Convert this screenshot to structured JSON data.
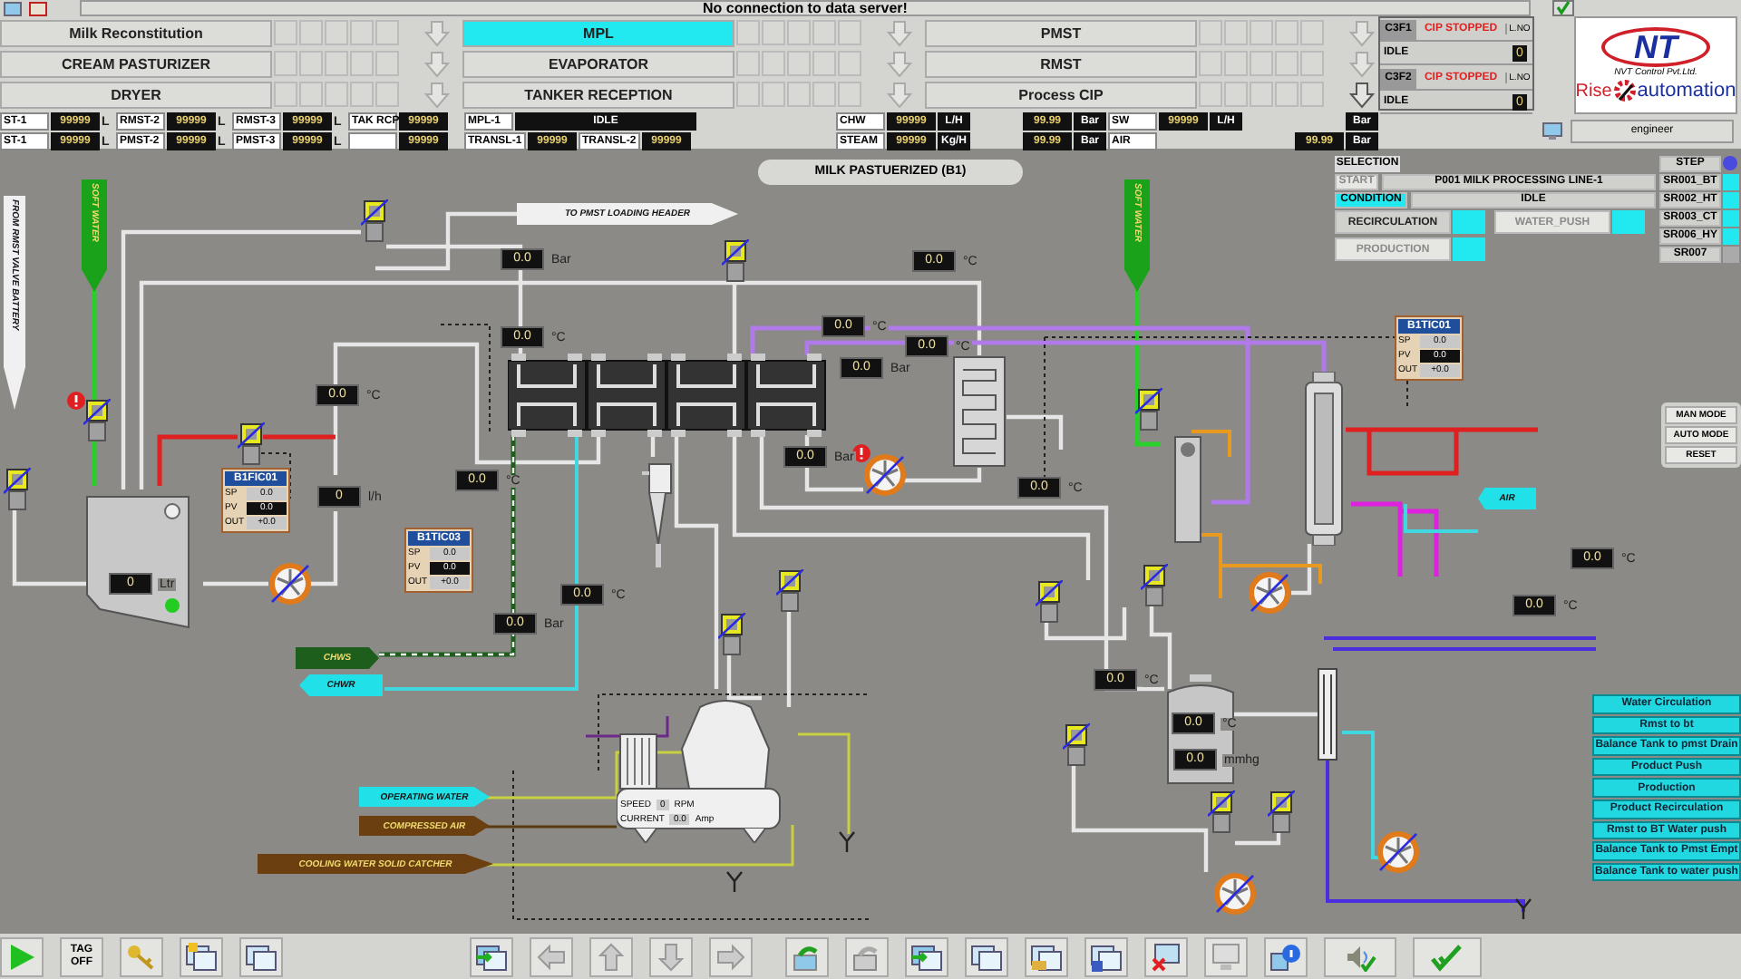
{
  "status_message": "No connection to data server!",
  "process_buttons": [
    {
      "label": "Milk Reconstitution",
      "selected": false
    },
    {
      "label": "MPL",
      "selected": true
    },
    {
      "label": "PMST",
      "selected": false
    },
    {
      "label": "CREAM PASTURIZER",
      "selected": false
    },
    {
      "label": "EVAPORATOR",
      "selected": false
    },
    {
      "label": "RMST",
      "selected": false
    },
    {
      "label": "DRYER",
      "selected": false
    },
    {
      "label": "TANKER RECEPTION",
      "selected": false
    },
    {
      "label": "Process CIP",
      "selected": false
    }
  ],
  "level_rows": [
    [
      {
        "label": "ST-1",
        "value": "99999",
        "unit": "L"
      },
      {
        "label": "RMST-2",
        "value": "99999",
        "unit": "L"
      },
      {
        "label": "RMST-3",
        "value": "99999",
        "unit": "L"
      },
      {
        "label": "TAK RCP",
        "value": "99999"
      },
      {
        "kind": "status",
        "label": "MPL-1",
        "value": "IDLE"
      }
    ],
    [
      {
        "label": "ST-1",
        "value": "99999",
        "unit": "L"
      },
      {
        "label": "PMST-2",
        "value": "99999",
        "unit": "L"
      },
      {
        "label": "PMST-3",
        "value": "99999",
        "unit": "L"
      },
      {
        "value": "99999"
      },
      {
        "kind": "pair",
        "label": "TRANSL-1",
        "value": "99999"
      },
      {
        "kind": "pair",
        "label": "TRANSL-2",
        "value": "99999"
      }
    ]
  ],
  "utility_rows": [
    [
      {
        "label": "CHW",
        "value": "99999",
        "unit": "L/H"
      },
      {
        "value": "99.99",
        "unit": "Bar"
      },
      {
        "label": "SW",
        "value": "99999",
        "unit": "L/H"
      },
      {
        "unit": "Bar"
      }
    ],
    [
      {
        "label": "STEAM",
        "value": "99999",
        "unit": "Kg/H"
      },
      {
        "value": "99.99",
        "unit": "Bar"
      },
      {
        "label": "AIR"
      },
      {
        "value": "99.99",
        "unit": "Bar"
      }
    ]
  ],
  "cip_units": [
    {
      "name": "C3F1",
      "status": "CIP STOPPED",
      "lno_label": "L.NO",
      "state": "IDLE",
      "line_no": "0"
    },
    {
      "name": "C3F2",
      "status": "CIP STOPPED",
      "lno_label": "L.NO",
      "state": "IDLE",
      "line_no": "0"
    }
  ],
  "logo": {
    "mark": "NT",
    "company": "NVT Control Pvt.Ltd.",
    "word_1": "Rise",
    "word_2": "automation"
  },
  "user": "engineer",
  "diagram": {
    "title": "MILK PASTUERIZED (B1)",
    "readings": [
      {
        "value": "0.0",
        "unit": "Bar"
      },
      {
        "value": "0.0",
        "unit": "°C"
      },
      {
        "value": "0.0",
        "unit": "°C"
      },
      {
        "value": "0",
        "unit": "l/h"
      },
      {
        "value": "0.0",
        "unit": "°C"
      },
      {
        "value": "0",
        "unit": "Ltr"
      },
      {
        "value": "0.0",
        "unit": "°C"
      },
      {
        "value": "0.0",
        "unit": "Bar"
      },
      {
        "value": "0.0",
        "unit": "°C"
      },
      {
        "value": "0.0",
        "unit": "°C"
      },
      {
        "value": "0.0",
        "unit": "°C"
      },
      {
        "value": "0.0",
        "unit": "Bar"
      },
      {
        "value": "0.0",
        "unit": "Bar"
      },
      {
        "value": "0.0",
        "unit": "°C"
      },
      {
        "value": "0.0",
        "unit": "°C"
      },
      {
        "value": "0.0",
        "unit": "°C"
      },
      {
        "value": "0.0",
        "unit": "°C"
      },
      {
        "value": "0.0",
        "unit": "°C"
      },
      {
        "value": "0.0",
        "unit": "mmhg"
      }
    ],
    "controllers": [
      {
        "tag": "B1FIC01",
        "rows": [
          {
            "kind": "setpoint",
            "label": "SP",
            "value": "0.0"
          },
          {
            "kind": "measured",
            "label": "PV",
            "value": "0.0"
          },
          {
            "kind": "output",
            "label": "OUT",
            "value": "+0.0"
          }
        ]
      },
      {
        "tag": "B1TIC03",
        "rows": [
          {
            "kind": "setpoint",
            "label": "SP",
            "value": "0.0"
          },
          {
            "kind": "measured",
            "label": "PV",
            "value": "0.0"
          },
          {
            "kind": "output",
            "label": "OUT",
            "value": "+0.0"
          }
        ]
      },
      {
        "tag": "B1TIC01",
        "rows": [
          {
            "kind": "setpoint",
            "label": "SP",
            "value": "0.0"
          },
          {
            "kind": "measured",
            "label": "PV",
            "value": "0.0"
          },
          {
            "kind": "output",
            "label": "OUT",
            "value": "+0.0"
          }
        ]
      }
    ],
    "line_tags": [
      {
        "text": "SOFT WATER",
        "color": "#1aa31a",
        "kind": "down"
      },
      {
        "text": "SOFT WATER",
        "color": "#1aa31a",
        "kind": "down"
      },
      {
        "text": "FROM RMST VALVE BATTERY",
        "color": "#f0f0f0",
        "kind": "down"
      },
      {
        "text": "TO PMST LOADING HEADER",
        "color": "#f0f0f0",
        "kind": "right"
      },
      {
        "text": "CHWS",
        "color": "#1d5e1d",
        "kind": "right"
      },
      {
        "text": "CHWR",
        "color": "#22e0e8",
        "kind": "left"
      },
      {
        "text": "AIR",
        "color": "#22e0e8",
        "kind": "left"
      },
      {
        "text": "OPERATING WATER",
        "color": "#22e0e8",
        "kind": "right"
      },
      {
        "text": "COMPRESSED AIR",
        "color": "#6b3f10",
        "kind": "right"
      },
      {
        "text": "COOLING WATER SOLID CATCHER",
        "color": "#6b3f10",
        "kind": "right"
      }
    ],
    "separator": {
      "speed_label": "SPEED",
      "speed": "0",
      "speed_unit": "RPM",
      "current_label": "CURRENT",
      "current": "0.0",
      "current_unit": "Amp"
    }
  },
  "selection": {
    "title": "SELECTION",
    "start": {
      "label": "START",
      "disabled": true
    },
    "line": "P001 MILK PROCESSING LINE-1",
    "step_label": "STEP",
    "condition": {
      "label": "CONDITION",
      "selected": true
    },
    "state": "IDLE",
    "modes": [
      {
        "label": "RECIRCULATION",
        "disabled": false
      },
      {
        "label": "WATER_PUSH",
        "disabled": true
      },
      {
        "label": "PRODUCTION",
        "disabled": true
      }
    ],
    "steps": [
      {
        "label": "SR001_BT",
        "active": true
      },
      {
        "label": "SR002_HT",
        "active": true
      },
      {
        "label": "SR003_CT",
        "active": true
      },
      {
        "label": "SR006_HY",
        "active": true
      },
      {
        "label": "SR007",
        "active": false
      }
    ]
  },
  "mode_buttons": [
    "MAN MODE",
    "AUTO MODE",
    "RESET"
  ],
  "sequence_buttons": [
    "Water Circulation",
    "Rmst to bt",
    "Balance Tank to pmst Drain",
    "Product Push",
    "Production",
    "Product Recirculation",
    "Rmst to BT Water push",
    "Balance Tank to Pmst Empt",
    "Balance Tank to water push"
  ],
  "toolbar": {
    "tag_button": "TAG OFF"
  }
}
